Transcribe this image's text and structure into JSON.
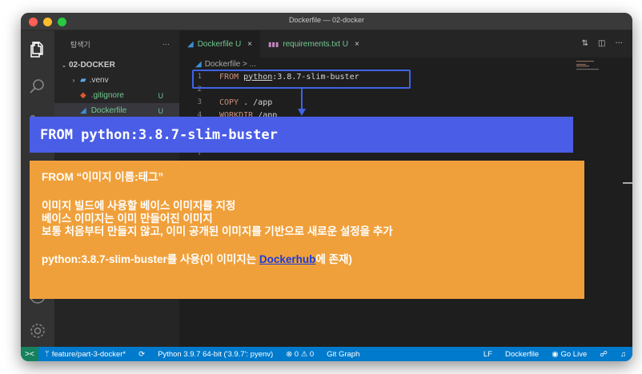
{
  "window": {
    "title": "Dockerfile — 02-docker"
  },
  "sidebar": {
    "title": "탐색기",
    "more": "···",
    "project": "02-DOCKER",
    "items": [
      {
        "label": ".venv",
        "badge": ""
      },
      {
        "label": ".gitignore",
        "badge": "U"
      },
      {
        "label": "Dockerfile",
        "badge": "U"
      }
    ]
  },
  "tabs": [
    {
      "label": "Dockerfile U",
      "close": "×"
    },
    {
      "label": "requirements.txt U",
      "close": "×"
    }
  ],
  "editor": {
    "breadcrumb": "Dockerfile > ...",
    "lines": [
      {
        "num": "1",
        "kw": "FROM ",
        "arg_underlined": "python",
        "rest": ":3.8.7-slim-buster"
      },
      {
        "num": "2",
        "kw": "",
        "arg_underlined": "",
        "rest": ""
      },
      {
        "num": "3",
        "kw": "COPY ",
        "arg_underlined": "",
        "rest": ". /app"
      },
      {
        "num": "4",
        "kw": "WORKDIR ",
        "arg_underlined": "",
        "rest": "/app"
      }
    ],
    "line7_num": "7"
  },
  "statusbar": {
    "remote": "><",
    "branch": "feature/part-3-docker*",
    "python": "Python 3.9.7 64-bit ('3.9.7': pyenv)",
    "problems": "⊗ 0 ⚠ 0",
    "git_graph": "Git Graph",
    "eol": "LF",
    "language": "Dockerfile",
    "go_live": "Go Live"
  },
  "overlay": {
    "banner": "FROM python:3.8.7-slim-buster",
    "syntax": "FROM “이미지 이름:태그”",
    "desc1": "이미지 빌드에 사용할 베이스 이미지를 지정",
    "desc2": "베이스 이미지는 이미 만들어진 이미지",
    "desc3": "보통 처음부터 만들지 않고, 이미 공개된 이미지를 기반으로 새로운 설정을 추가",
    "usage_prefix": "python:3.8.7-slim-buster를 사용(이 이미지는 ",
    "usage_link": "Dockerhub",
    "usage_suffix": "에 존재)"
  },
  "colors": {
    "banner": "#4a5de6",
    "panel": "#f0a03a",
    "highlight": "#3f63e6",
    "statusbar": "#007acc"
  }
}
